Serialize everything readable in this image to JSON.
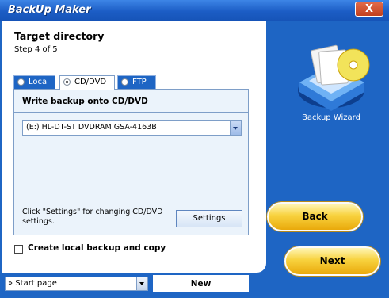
{
  "window": {
    "title": "BackUp Maker",
    "close_label": "X"
  },
  "header": {
    "title": "Target directory",
    "step": "Step 4 of 5"
  },
  "tabs": [
    {
      "label": "Local",
      "active": false
    },
    {
      "label": "CD/DVD",
      "active": true
    },
    {
      "label": "FTP",
      "active": false
    }
  ],
  "panel": {
    "title": "Write backup onto CD/DVD",
    "drive": "(E:) HL-DT-ST DVDRAM GSA-4163B",
    "hint": "Click \"Settings\" for changing CD/DVD settings.",
    "settings_label": "Settings"
  },
  "options": {
    "local_copy_label": "Create local backup and copy",
    "local_copy_checked": false
  },
  "sidebar": {
    "wizard_label": "Backup Wizard",
    "back_label": "Back",
    "next_label": "Next"
  },
  "footer": {
    "start_select": "» Start page",
    "new_label": "New"
  },
  "colors": {
    "titlebar": "#1c5dc5",
    "client": "#1e65c4",
    "button_gold": "#f8d23e",
    "panel_bg": "#ebf3fb"
  }
}
